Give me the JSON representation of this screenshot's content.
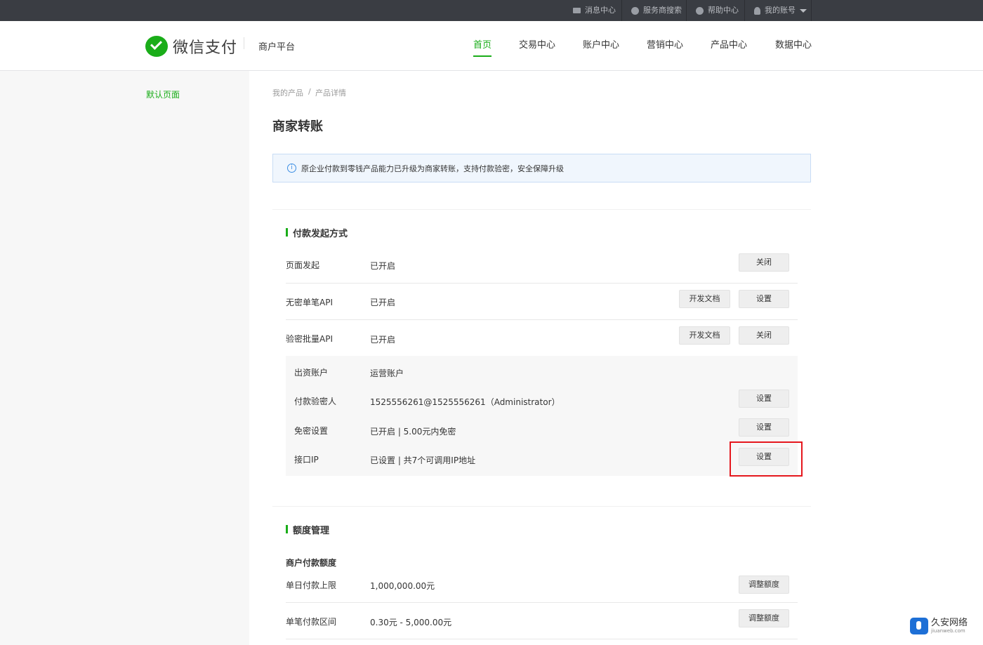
{
  "topbar": {
    "items": [
      {
        "label": "消息中心",
        "icon": "mail-icon"
      },
      {
        "label": "服务商搜索",
        "icon": "search-circle-icon"
      },
      {
        "label": "帮助中心",
        "icon": "help-icon"
      },
      {
        "label": "我的账号",
        "icon": "user-icon"
      }
    ]
  },
  "header": {
    "logo_text": "微信支付",
    "platform": "商户平台",
    "nav": [
      "首页",
      "交易中心",
      "账户中心",
      "营销中心",
      "产品中心",
      "数据中心"
    ],
    "active_nav": "首页"
  },
  "sidebar": {
    "items": [
      "默认页面"
    ]
  },
  "breadcrumb": [
    "我的产品",
    "/",
    "产品详情"
  ],
  "page_title": "商家转账",
  "notice": {
    "icon": "info-icon",
    "text": "原企业付款到零钱产品能力已升级为商家转账，支持付款验密，安全保障升级"
  },
  "payment_section": {
    "title": "付款发起方式",
    "rows": [
      {
        "label": "页面发起",
        "value": "已开启",
        "doc_button": "",
        "action_button": "关闭"
      },
      {
        "label": "无密单笔API",
        "value": "已开启",
        "doc_button": "开发文档",
        "action_button": "设置"
      },
      {
        "label": "验密批量API",
        "value": "已开启",
        "doc_button": "开发文档",
        "action_button": "关闭"
      }
    ],
    "sub_rows": [
      {
        "label": "出资账户",
        "value": "运营账户",
        "action_button": ""
      },
      {
        "label": "付款验密人",
        "value": "1525556261@1525556261（Administrator）",
        "action_button": "设置"
      },
      {
        "label": "免密设置",
        "value": "已开启 | 5.00元内免密",
        "action_button": "设置"
      },
      {
        "label": "接口IP",
        "value": "已设置 | 共7个可调用IP地址",
        "action_button": "设置"
      }
    ]
  },
  "quota_section": {
    "title": "额度管理",
    "subhead": "商户付款额度",
    "rows": [
      {
        "label": "单日付款上限",
        "value": "1,000,000.00元",
        "action_button": "调整额度"
      },
      {
        "label": "单笔付款区间",
        "value": "0.30元 - 5,000.00元",
        "action_button": "调整额度"
      }
    ]
  },
  "watermark": {
    "cn": "久安网络",
    "en": "jiuanweb.com"
  },
  "colors": {
    "brand_green": "#1aad19",
    "topbar_bg": "#3a3d43",
    "highlight_red": "#e5171d",
    "notice_bg": "#f0f6fd"
  }
}
